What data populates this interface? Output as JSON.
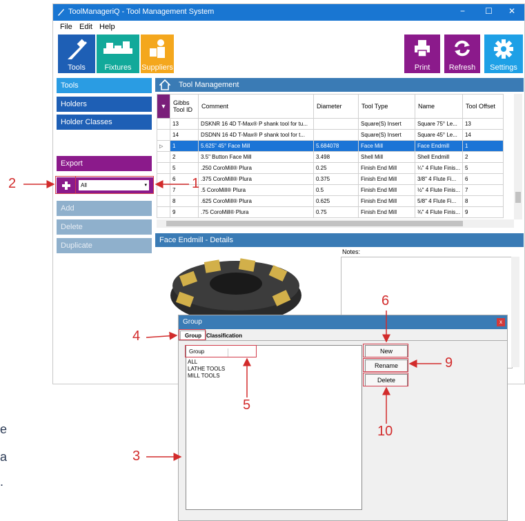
{
  "window": {
    "title": "ToolManageriQ - Tool Management System",
    "minimize": "−",
    "maximize": "☐",
    "close": "✕"
  },
  "menu": [
    "File",
    "Edit",
    "Help"
  ],
  "toolbar": {
    "tools": "Tools",
    "fixtures": "Fixtures",
    "suppliers": "Suppliers",
    "print": "Print",
    "refresh": "Refresh",
    "settings": "Settings"
  },
  "sidebar": {
    "tools": "Tools",
    "holders": "Holders",
    "holder_classes": "Holder Classes",
    "export": "Export",
    "filter_value": "All",
    "add": "Add",
    "delete": "Delete",
    "duplicate": "Duplicate"
  },
  "main": {
    "header": "Tool Management",
    "columns": [
      "Gibbs Tool ID",
      "Comment",
      "Diameter",
      "Tool Type",
      "Name",
      "Tool Offset"
    ],
    "rows": [
      {
        "id": "13",
        "comment": "DSKNR 16 4D T-Max® P shank tool for tu...",
        "diameter": "",
        "type": "Square(S) Insert",
        "name": "Square 75° Le...",
        "offset": "13"
      },
      {
        "id": "14",
        "comment": "DSDNN 16 4D T-Max® P shank tool for t...",
        "diameter": "",
        "type": "Square(S) Insert",
        "name": "Square 45° Le...",
        "offset": "14"
      },
      {
        "id": "1",
        "comment": "5.625\" 45° Face Mill",
        "diameter": "5.684078",
        "type": "Face Mill",
        "name": "Face Endmill",
        "offset": "1"
      },
      {
        "id": "2",
        "comment": "3.5\" Button Face Mill",
        "diameter": "3.498",
        "type": "Shell Mill",
        "name": "Shell Endmill",
        "offset": "2"
      },
      {
        "id": "5",
        "comment": ".250 CoroMill® Plura",
        "diameter": "0.25",
        "type": "Finish End Mill",
        "name": "¼\" 4 Flute Finis...",
        "offset": "5"
      },
      {
        "id": "6",
        "comment": ".375 CoroMill® Plura",
        "diameter": "0.375",
        "type": "Finish End Mill",
        "name": "3/8\" 4 Flute Fi...",
        "offset": "6"
      },
      {
        "id": "7",
        "comment": ".5 CoroMill® Plura",
        "diameter": "0.5",
        "type": "Finish End Mill",
        "name": "½\" 4 Flute Finis...",
        "offset": "7"
      },
      {
        "id": "8",
        "comment": ".625 CoroMill® Plura",
        "diameter": "0.625",
        "type": "Finish End Mill",
        "name": "5/8\" 4 Flute Fi...",
        "offset": "8"
      },
      {
        "id": "9",
        "comment": ".75 CoroMill® Plura",
        "diameter": "0.75",
        "type": "Finish End Mill",
        "name": "¾\" 4 Flute Finis...",
        "offset": "9"
      }
    ],
    "details_header": "Face Endmill - Details",
    "notes_label": "Notes:"
  },
  "dialog": {
    "title": "Group",
    "close": "x",
    "tab_group": "Group",
    "tab_classification": "Classification",
    "list_header": "Group",
    "items": [
      "ALL",
      "LATHE TOOLS",
      "MILL TOOLS"
    ],
    "btn_new": "New",
    "btn_rename": "Rename",
    "btn_delete": "Delete"
  },
  "callouts": [
    "1",
    "2",
    "3",
    "4",
    "5",
    "6",
    "9",
    "10"
  ],
  "side_text": [
    "e",
    "a",
    "."
  ],
  "colors": {
    "title_blue": "#1976d2",
    "sidebar_blue": "#1e5fb5",
    "accent_purple": "#8b1a8b",
    "selection": "#1b74d6",
    "callout_red": "#d22b2b"
  }
}
